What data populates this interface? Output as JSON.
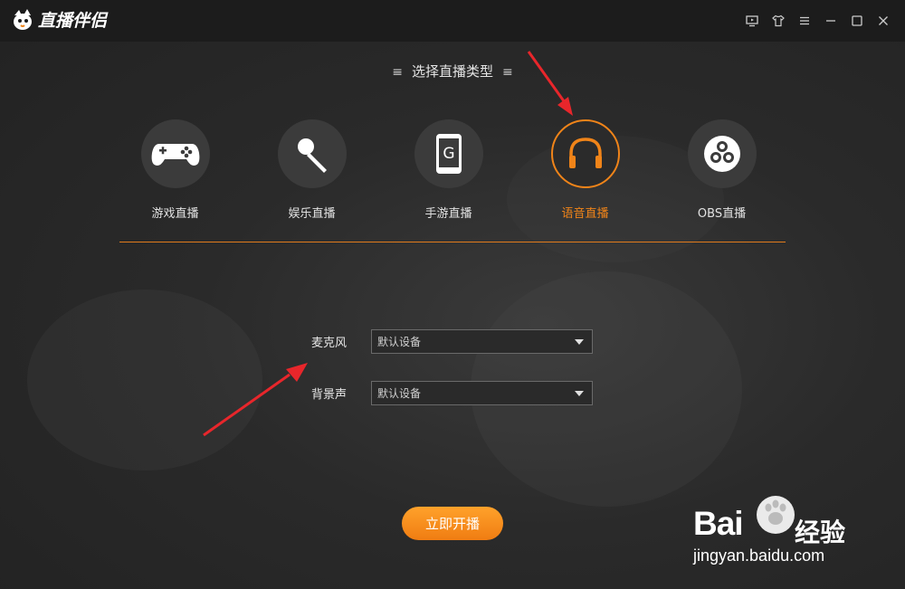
{
  "app": {
    "title": "直播伴侣"
  },
  "window_controls": [
    {
      "name": "screen-icon"
    },
    {
      "name": "tshirt-icon"
    },
    {
      "name": "menu-icon"
    },
    {
      "name": "minimize-icon"
    },
    {
      "name": "maximize-icon"
    },
    {
      "name": "close-icon"
    }
  ],
  "section_title": "选择直播类型",
  "stream_types": [
    {
      "label": "游戏直播",
      "icon": "gamepad-icon",
      "active": false
    },
    {
      "label": "娱乐直播",
      "icon": "microphone-icon",
      "active": false
    },
    {
      "label": "手游直播",
      "icon": "phone-icon",
      "active": false
    },
    {
      "label": "语音直播",
      "icon": "headphones-icon",
      "active": true
    },
    {
      "label": "OBS直播",
      "icon": "obs-icon",
      "active": false
    }
  ],
  "form": {
    "microphone": {
      "label": "麦克风",
      "value": "默认设备"
    },
    "background_sound": {
      "label": "背景声",
      "value": "默认设备"
    }
  },
  "start_button": "立即开播",
  "watermark": {
    "brand": "Bai",
    "brand_cn": "经验",
    "url": "jingyan.baidu.com"
  },
  "colors": {
    "accent": "#f08419",
    "titlebar": "#1c1c1c",
    "background": "#262626",
    "arrow": "#e8262b"
  }
}
